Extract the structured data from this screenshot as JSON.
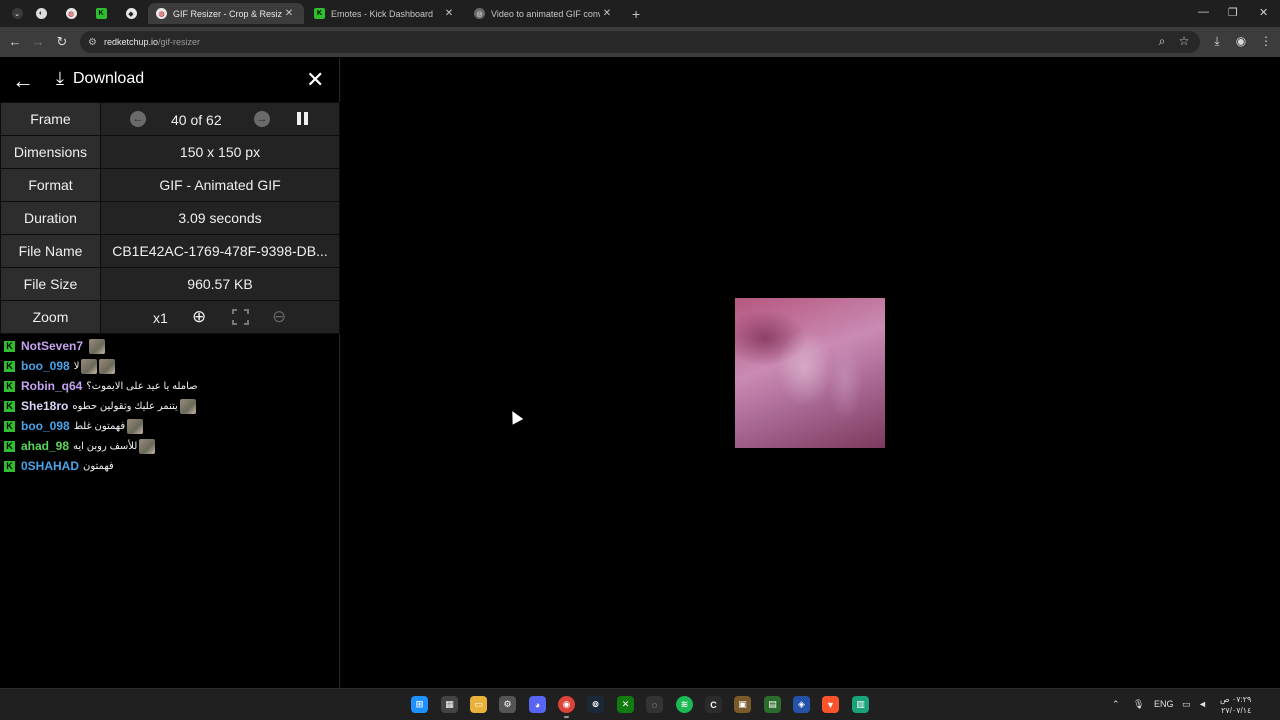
{
  "browser": {
    "tabs": [
      {
        "title": "",
        "icon": "chevron-down-icon"
      },
      {
        "title": "",
        "icon": "circle-icon"
      },
      {
        "title": "",
        "icon": "redketchup-icon"
      },
      {
        "title": "",
        "icon": "kick-icon"
      },
      {
        "title": "",
        "icon": "extension-icon"
      },
      {
        "title": "GIF Resizer - Crop & Resize Ani",
        "icon": "redketchup-icon",
        "active": true
      },
      {
        "title": "Emotes - Kick Dashboard",
        "icon": "kick-icon"
      },
      {
        "title": "Video to animated GIF converte",
        "icon": "globe-icon"
      }
    ],
    "new_tab": "+",
    "window_controls": {
      "minimize": "—",
      "restore": "❐",
      "close": "✕"
    },
    "url_host": "redketchup.io",
    "url_path": "/gif-resizer"
  },
  "panel": {
    "title": "Download",
    "rows": {
      "frame": {
        "label": "Frame",
        "value": "40 of 62"
      },
      "dimensions": {
        "label": "Dimensions",
        "value": "150 x 150 px"
      },
      "format": {
        "label": "Format",
        "value": "GIF - Animated GIF"
      },
      "duration": {
        "label": "Duration",
        "value": "3.09 seconds"
      },
      "filename": {
        "label": "File Name",
        "value": "CB1E42AC-1769-478F-9398-DB..."
      },
      "filesize": {
        "label": "File Size",
        "value": "960.57 KB"
      },
      "zoom": {
        "label": "Zoom",
        "value": "x1"
      }
    }
  },
  "chat": [
    {
      "user": "NotSeven7",
      "color": "#c6a3f0",
      "msg": "",
      "emotes": 1
    },
    {
      "user": "boo_098",
      "color": "#4aa3e8",
      "msg": "لا",
      "emotes": 2
    },
    {
      "user": "Robin_q64",
      "color": "#c6a3f0",
      "msg": "صامله يا عيد على الايموت؟",
      "emotes": 0
    },
    {
      "user": "She18ro",
      "color": "#d8d8f8",
      "msg": "يتنمر عليك وتقولين حطوه",
      "emotes": 1
    },
    {
      "user": "boo_098",
      "color": "#4aa3e8",
      "msg": "فهمتون غلط",
      "emotes": 1
    },
    {
      "user": "ahad_98",
      "color": "#58d858",
      "msg": "للأسف روبن ايه",
      "emotes": 1
    },
    {
      "user": "0SHAHAD",
      "color": "#4aa3e8",
      "msg": "فهمتون",
      "emotes": 0
    }
  ],
  "taskbar": {
    "lang": "ENG",
    "time": "٠٧:٢٩ ص",
    "date": "٢٧/٠٧/١٤"
  }
}
